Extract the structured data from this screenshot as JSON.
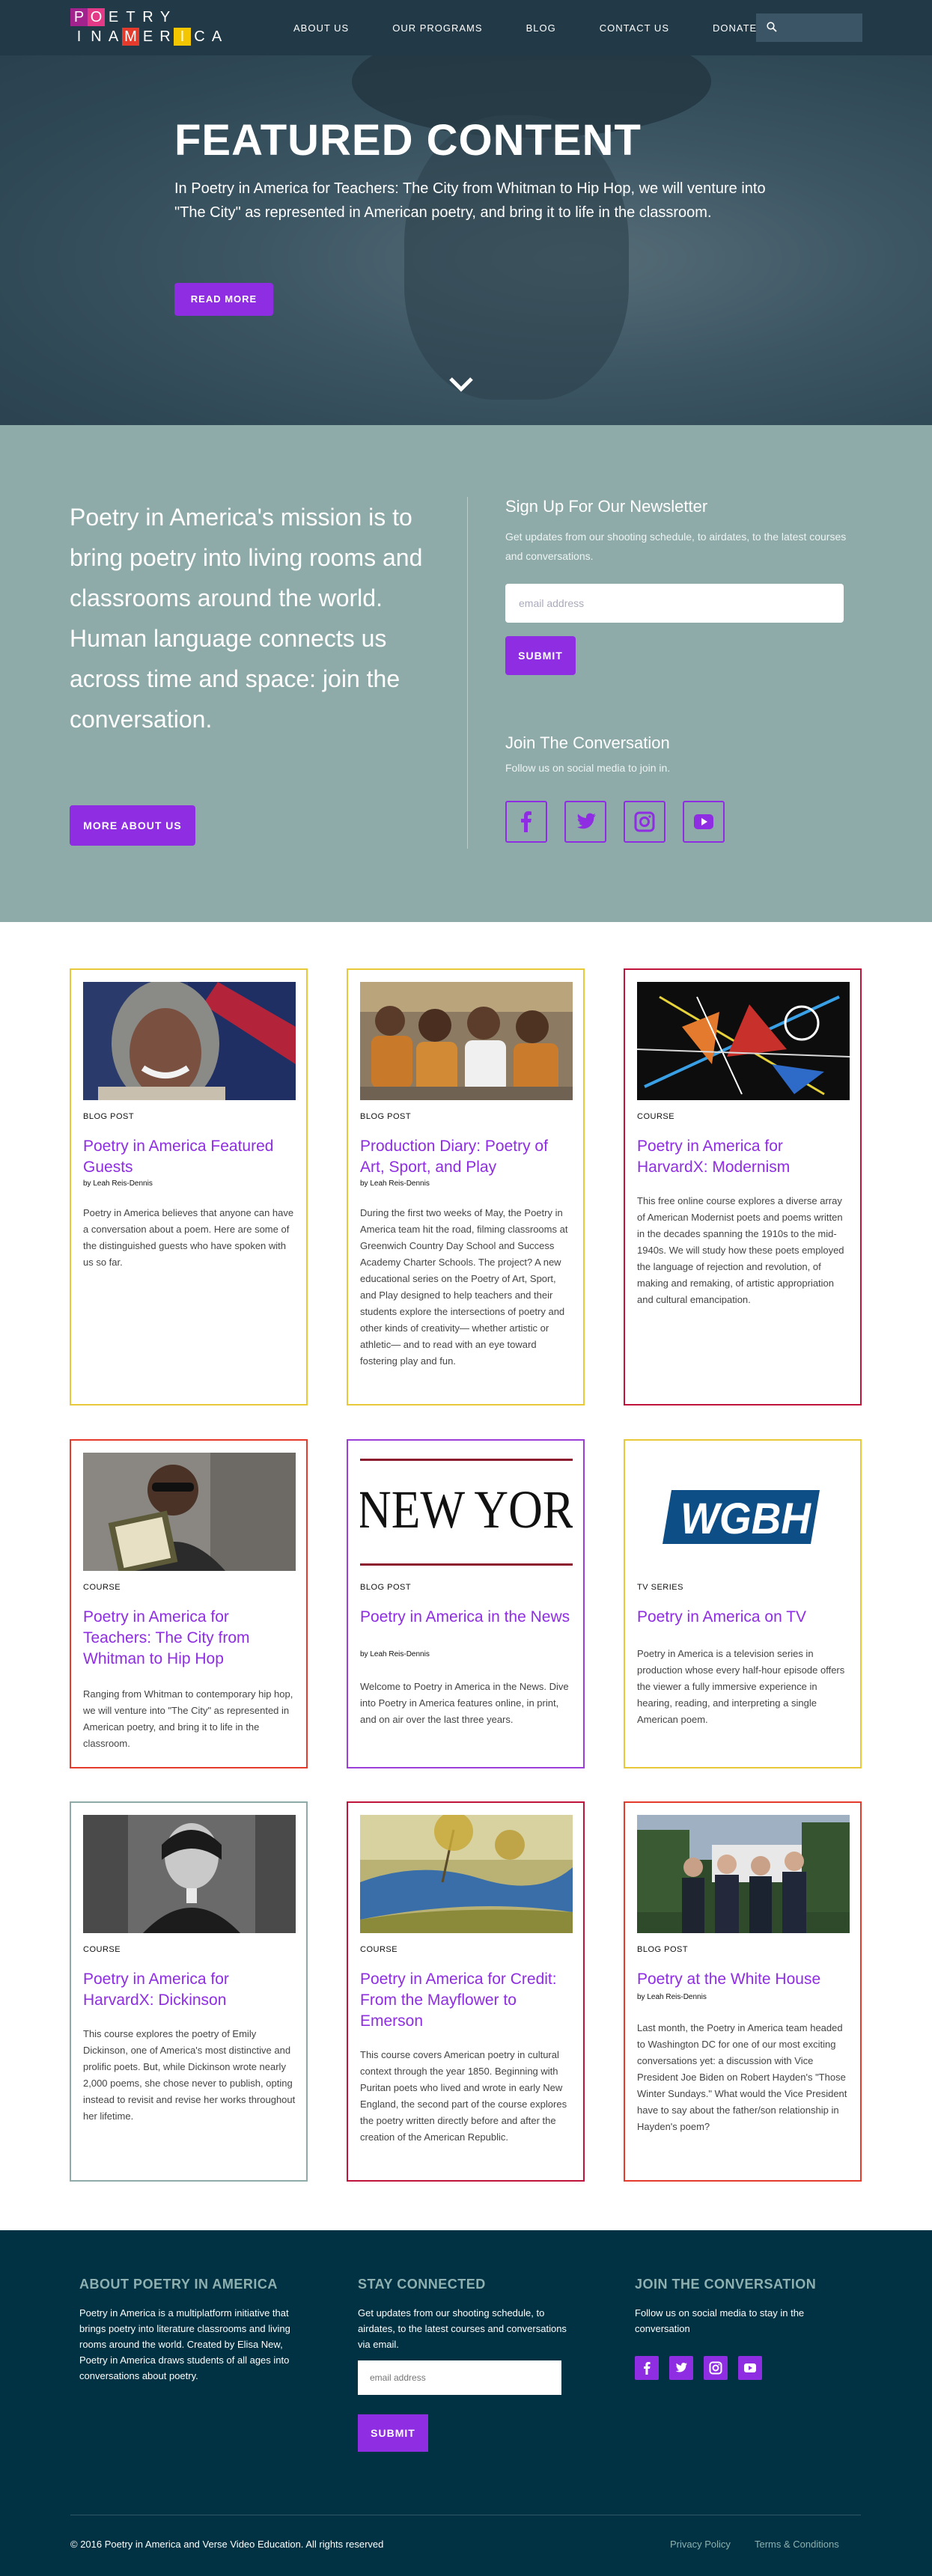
{
  "logo": {
    "row1": [
      "P",
      "O",
      "E",
      "T",
      "R",
      "Y"
    ],
    "row2": [
      "I",
      "N",
      "A",
      "M",
      "E",
      "R",
      "I",
      "C",
      "A"
    ],
    "row1_colors": [
      "#a3238e",
      "#e23a86",
      "#ffffff",
      "#ffffff",
      "#ffffff",
      "#ffffff"
    ],
    "row2_colors": [
      "#ffffff",
      "#ffffff",
      "#ffffff",
      "#e53b2c",
      "#ffffff",
      "#ffffff",
      "#f4c600",
      "#ffffff",
      "#ffffff"
    ],
    "row2_boxes": [
      false,
      false,
      false,
      true,
      false,
      false,
      true,
      false,
      false
    ]
  },
  "nav": {
    "items": [
      {
        "label": "ABOUT US"
      },
      {
        "label": "OUR PROGRAMS"
      },
      {
        "label": "BLOG"
      },
      {
        "label": "CONTACT US"
      },
      {
        "label": "DONATE"
      }
    ],
    "search_icon": "search-icon"
  },
  "hero": {
    "title": "FEATURED CONTENT",
    "text": "In Poetry in America for Teachers: The City from Whitman to Hip Hop, we will venture into \"The City\" as represented in American poetry, and bring it to life in the classroom.",
    "button": "READ MORE",
    "scroll_icon": "chevron-down-icon"
  },
  "mission": {
    "text": "Poetry in America's mission is to bring poetry into living rooms and classrooms around the world. Human language connects us across time and space: join the conversation.",
    "button": "MORE ABOUT US"
  },
  "newsletter": {
    "title": "Sign Up For Our Newsletter",
    "text": "Get updates from our shooting schedule, to airdates, to the latest courses and conversations.",
    "placeholder": "email address",
    "submit": "SUBMIT"
  },
  "conversation": {
    "title": "Join The Conversation",
    "text": "Follow us on social media to join in.",
    "icons": [
      "facebook-icon",
      "twitter-icon",
      "instagram-icon",
      "youtube-icon"
    ]
  },
  "cards": [
    {
      "type": "BLOG POST",
      "title": "Poetry in America Featured Guests",
      "author": "by Leah Reis-Dennis",
      "desc": "Poetry in America believes that anyone can have a conversation about a poem. Here are some of the distinguished guests who have spoken with us so far.",
      "border": "#e8c93a"
    },
    {
      "type": "BLOG POST",
      "title": "Production Diary: Poetry of Art, Sport, and Play",
      "author": "by Leah Reis-Dennis",
      "desc": "During the first two weeks of May, the Poetry in America team hit the road, filming classrooms at Greenwich Country Day School and Success Academy Charter Schools. The project? A new educational series on the Poetry of Art, Sport, and Play designed to help teachers and their students explore the intersections of poetry and other kinds of creativity— whether artistic or athletic— and to read with an eye toward fostering play and fun.",
      "border": "#e8c93a"
    },
    {
      "type": "COURSE",
      "title": "Poetry in America for HarvardX: Modernism",
      "author": "",
      "desc": "This free online course explores a diverse array of American Modernist poets and poems written in the decades spanning the 1910s to the mid-1940s. We will study how these poets employed the language of rejection and revolution, of making and remaking, of artistic appropriation and cultural emancipation.",
      "border": "#c0143c"
    },
    {
      "type": "COURSE",
      "title": "Poetry in America for Teachers: The City from Whitman to Hip Hop",
      "author": "",
      "desc": "Ranging from Whitman to contemporary hip hop, we will venture into \"The City\" as represented in American poetry, and bring it to life in the classroom.",
      "border": "#e53b2c"
    },
    {
      "type": "BLOG POST",
      "title": "Poetry in America in the News",
      "author": "by Leah Reis-Dennis",
      "desc": "Welcome to Poetry in America in the News. Dive into Poetry in America features online, in print, and on air over the last three years.",
      "border": "#9b3fd8"
    },
    {
      "type": "TV SERIES",
      "title": "Poetry in America on TV",
      "author": "",
      "desc": "Poetry in America is a television series in production whose every half-hour episode offers the viewer a fully immersive experience in hearing, reading, and interpreting a single American poem.",
      "border": "#e8c93a"
    },
    {
      "type": "COURSE",
      "title": "Poetry in America for HarvardX: Dickinson",
      "author": "",
      "desc": "This course explores the poetry of Emily Dickinson, one of America's most distinctive and prolific poets. But, while Dickinson wrote nearly 2,000 poems, she chose never to publish, opting instead to revisit and revise her works throughout her lifetime.",
      "border": "#8eaba9"
    },
    {
      "type": "COURSE",
      "title": "Poetry in America for Credit: From the Mayflower to Emerson",
      "author": "",
      "desc": "This course covers American poetry in cultural context through the year 1850. Beginning with Puritan poets who lived and wrote in early New England, the second part of the course explores the poetry written directly before and after the creation of the American Republic.",
      "border": "#c0143c"
    },
    {
      "type": "BLOG POST",
      "title": "Poetry at the White House",
      "author": "by Leah Reis-Dennis",
      "desc": "Last month, the Poetry in America team headed to Washington DC for one of our most exciting conversations yet: a discussion with Vice President Joe Biden on Robert Hayden's \"Those Winter Sundays.\" What would the Vice President have to say about the father/son relationship in Hayden's poem?",
      "border": "#e53b2c"
    }
  ],
  "card_images": {
    "news_text": "NEW YOR",
    "wgbh_text": "WGBH"
  },
  "footer": {
    "about_title": "ABOUT POETRY IN AMERICA",
    "about_text": "Poetry in America is a multiplatform initiative that brings poetry into literature classrooms and living rooms around the world. Created by Elisa New, Poetry in America draws students of all ages into conversations about poetry.",
    "stay_title": "STAY CONNECTED",
    "stay_text": "Get updates from our shooting schedule, to airdates, to the latest courses and conversations via email.",
    "placeholder": "email address",
    "submit": "SUBMIT",
    "join_title": "JOIN THE CONVERSATION",
    "join_text": "Follow us on social media to stay in the conversation",
    "copyright": "© 2016 Poetry in America and Verse Video Education. All rights reserved",
    "privacy": "Privacy Policy",
    "terms": "Terms & Conditions"
  },
  "colors": {
    "accent": "#8e2de2",
    "header": "#223a48",
    "mission_bg": "#8eaba9",
    "footer_bg": "#003243"
  }
}
